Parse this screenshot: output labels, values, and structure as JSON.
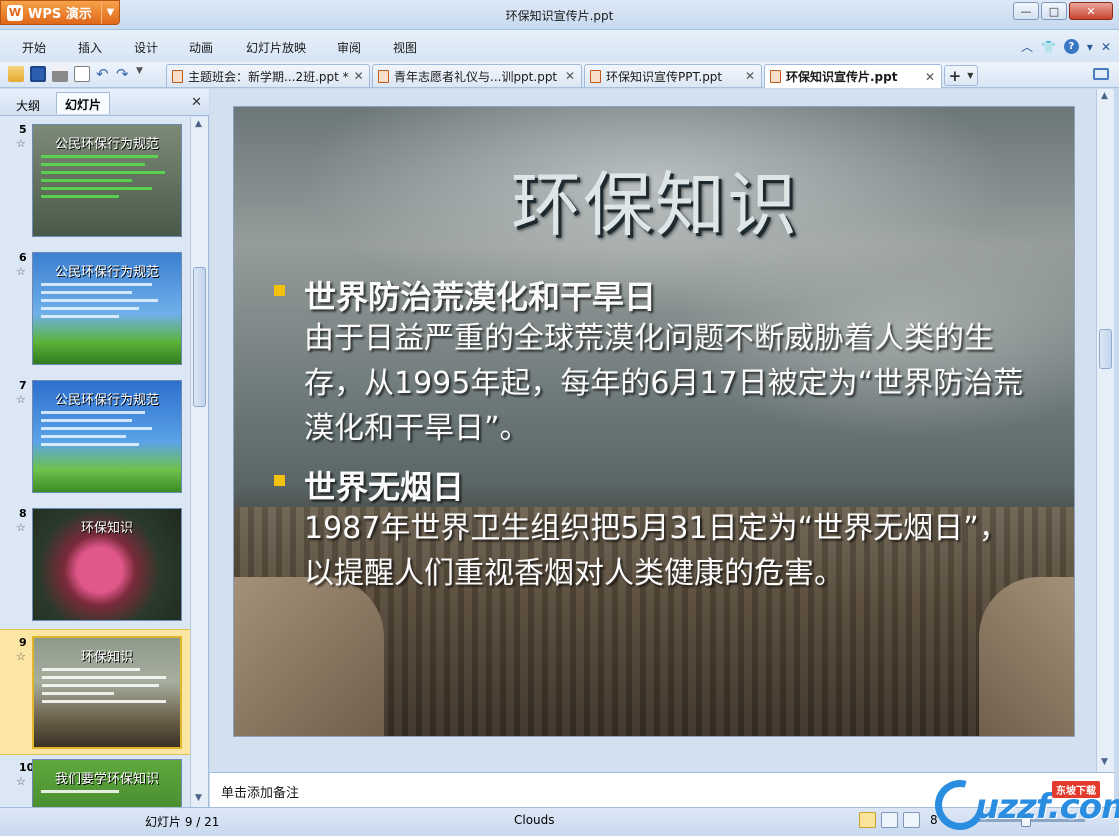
{
  "app": {
    "name": "WPS 演示",
    "window_title": "环保知识宣传片.ppt"
  },
  "menu": [
    "开始",
    "插入",
    "设计",
    "动画",
    "幻灯片放映",
    "审阅",
    "视图"
  ],
  "doc_tabs": [
    {
      "label": "主题班会：新学期...2班.ppt *"
    },
    {
      "label": "青年志愿者礼仪与...训ppt.ppt"
    },
    {
      "label": "环保知识宣传PPT.ppt"
    },
    {
      "label": "环保知识宣传片.ppt"
    }
  ],
  "left_panel": {
    "tabs": [
      "大纲",
      "幻灯片"
    ],
    "thumbnails": [
      {
        "num": "5",
        "title": "公民环保行为规范",
        "bg": "#5a6a5a"
      },
      {
        "num": "6",
        "title": "公民环保行为规范",
        "bg": "#2f6fc0"
      },
      {
        "num": "7",
        "title": "公民环保行为规范",
        "bg": "#2f7fd0"
      },
      {
        "num": "8",
        "title": "环保知识",
        "bg": "#2a3a2a"
      },
      {
        "num": "9",
        "title": "环保知识",
        "bg": "#7a8a6a"
      },
      {
        "num": "10",
        "title": "我们要学环保知识",
        "bg": "#3f7a2f"
      }
    ]
  },
  "slide": {
    "title": "环保知识",
    "bullets": [
      {
        "heading": "世界防治荒漠化和干旱日",
        "body": "由于日益严重的全球荒漠化问题不断威胁着人类的生存，从1995年起，每年的6月17日被定为“世界防治荒漠化和干旱日”。"
      },
      {
        "heading": "世界无烟日",
        "body": "1987年世界卫生组织把5月31日定为“世界无烟日”，以提醒人们重视香烟对人类健康的危害。"
      }
    ]
  },
  "notes": {
    "placeholder": "单击添加备注"
  },
  "status": {
    "slide_counter": "幻灯片 9 / 21",
    "theme": "Clouds",
    "zoom": "8"
  },
  "watermark": {
    "text": "uzzf.com",
    "badge": "东坡下载"
  },
  "colors": {
    "accent": "#e0681a",
    "bullet": "#f4c10e"
  }
}
